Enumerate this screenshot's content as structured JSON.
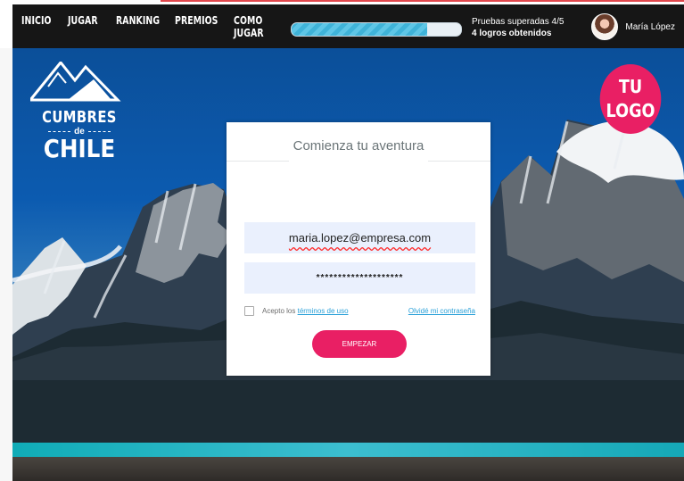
{
  "nav": {
    "items": [
      "INICIO",
      "JUGAR",
      "RANKING",
      "PREMIOS",
      "COMO JUGAR"
    ]
  },
  "progress": {
    "fraction": 0.8,
    "tests_label": "Pruebas superadas 4/5",
    "achievements_label": "4 logros obtenidos"
  },
  "user": {
    "name": "María López"
  },
  "brand": {
    "top": "CUMBRES",
    "middle": "de",
    "bottom": "CHILE",
    "placeholder_logo": [
      "TU",
      "LOGO"
    ]
  },
  "login": {
    "title": "Comienza tu aventura",
    "email_value": "maria.lopez@empresa.com",
    "password_value": "********************",
    "terms_prefix": "Acepto los",
    "terms_link": "términos de uso",
    "forgot_link": "Olvidé mi contraseña",
    "start_button": "EMPEZAR"
  },
  "colors": {
    "accent": "#e91f64",
    "link": "#29a0d8",
    "nav": "#161616",
    "input": "#eaf0fd"
  },
  "icons": {
    "logo": "mountain-logo-icon",
    "avatar": "user-avatar"
  }
}
